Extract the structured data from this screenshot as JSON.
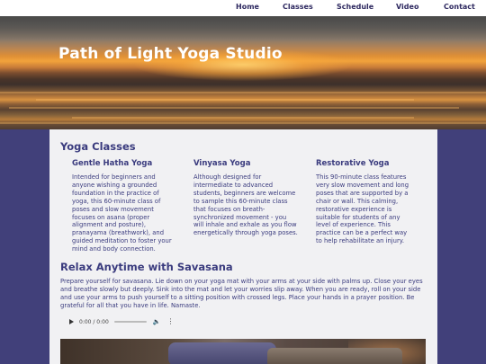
{
  "nav": {
    "home": "Home",
    "classes": "Classes",
    "schedule": "Schedule",
    "video": "Video",
    "contact": "Contact"
  },
  "banner": {
    "title": "Path of Light Yoga Studio"
  },
  "classes": {
    "heading": "Yoga Classes",
    "items": [
      {
        "title": "Gentle Hatha Yoga",
        "text": "Intended for beginners and anyone wishing a grounded foundation in the practice of yoga, this 60-minute class of poses and slow movement focuses on asana (proper alignment and posture), pranayama (breathwork), and guided meditation to foster your mind and body connection."
      },
      {
        "title": "Vinyasa Yoga",
        "text": "Although designed for intermediate to advanced students, beginners are welcome to sample this 60-minute class that focuses on breath-synchronized movement - you will inhale and exhale as you flow energetically through yoga poses."
      },
      {
        "title": "Restorative Yoga",
        "text": "This 90-minute class features very slow movement and long poses that are supported by a chair or wall. This calming, restorative experience is suitable for students of any level of experience. This practice can be a perfect way to help rehabilitate an injury."
      }
    ]
  },
  "relax": {
    "heading": "Relax Anytime with Savasana",
    "text": "Prepare yourself for savasana. Lie down on your yoga mat with your arms at your side with palms up. Close your eyes and breathe slowly but deeply. Sink into the mat and let your worries slip away. When you are ready, roll on your side and use your arms to push yourself to a sitting position with crossed legs. Place your hands in a prayer position. Be grateful for all that you have in life. Namaste."
  },
  "audio": {
    "time": "0:00 / 0:00",
    "play_icon": "play-icon",
    "volume_icon": "volume-icon",
    "more_icon": "more-options-icon"
  },
  "colors": {
    "page_background": "#41407a",
    "content_background": "#f1f1f3",
    "heading_text": "#3a3b7e"
  }
}
